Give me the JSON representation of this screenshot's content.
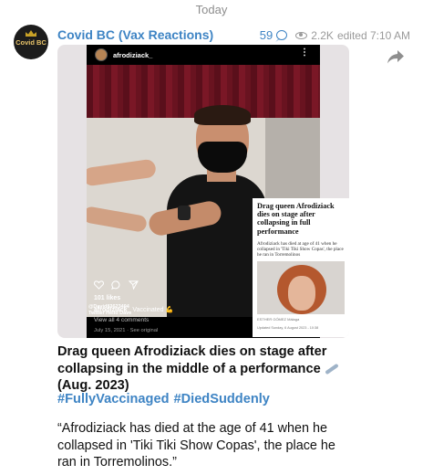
{
  "date_separator": "Today",
  "channel": {
    "avatar_text": "Covid BC",
    "name": "Covid BC (Vax Reactions)"
  },
  "message_meta": {
    "comments_count": "59",
    "views": "2.2K",
    "edited_label": "edited 7:10 AM",
    "comment_icon": "speech-bubble-icon",
    "views_icon": "eye-icon",
    "share_icon": "share-arrow-icon"
  },
  "instagram_post": {
    "username": "afrodiziack_",
    "photo_credit": "@David83623494\nTwitter Hello Dave",
    "likes": "101 likes",
    "caption_user": "afrodiziack_",
    "caption_text": "Vaccinated 💪",
    "comments_link": "View all 4 comments",
    "date": "July 15, 2021 · See original"
  },
  "article": {
    "title": "Drag queen Afrodiziack dies on stage after collapsing in full performance",
    "subtitle": "Afrodiziack has died at age of 41 when he collapsed in 'Tiki Tiki Show Copas', the place he ran in Torremolinos",
    "byline": "ESTHER GÓMEZ   Málaga",
    "footer": "Updated Sunday, 6 August 2023 - 10:38"
  },
  "headline": "Drag queen Afrodiziack dies on stage after collapsing in the middle of a performance",
  "headline_year": "(Aug. 2023)",
  "hashtags": [
    "#FullyVaccinaged",
    "#DiedSuddenly"
  ],
  "quote": "“Afrodiziack has died at the age of 41 when he collapsed in 'Tiki Tiki Show Copas', the place he ran in Torremolinos.”",
  "colors": {
    "accent": "#3e84c4",
    "meta_gray": "#9a9a9a"
  }
}
